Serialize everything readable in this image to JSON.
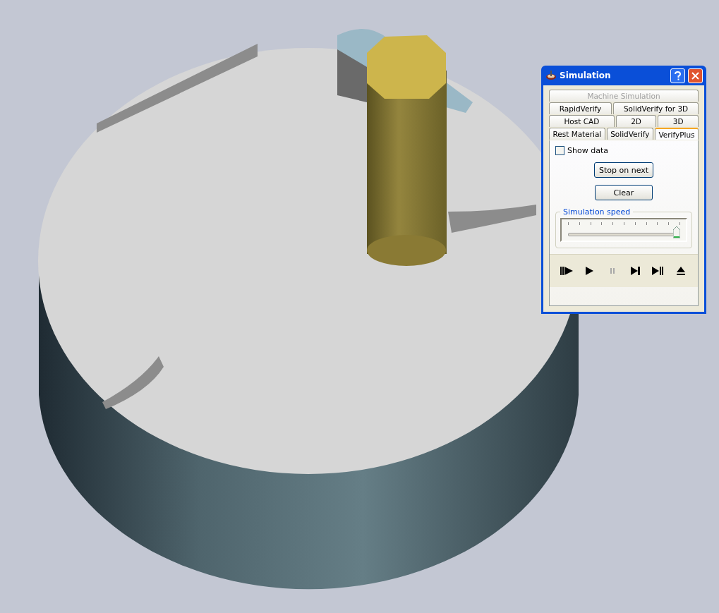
{
  "window": {
    "title": "Simulation"
  },
  "tab_rows": [
    [
      {
        "label": "Machine Simulation",
        "selected": false,
        "disabled": true
      }
    ],
    [
      {
        "label": "RapidVerify",
        "selected": false,
        "disabled": false
      },
      {
        "label": "SolidVerify for 3D",
        "selected": false,
        "disabled": false
      }
    ],
    [
      {
        "label": "Host CAD",
        "selected": false,
        "disabled": false
      },
      {
        "label": "2D",
        "selected": false,
        "disabled": false
      },
      {
        "label": "3D",
        "selected": false,
        "disabled": false
      }
    ],
    [
      {
        "label": "Rest Material",
        "selected": false,
        "disabled": false
      },
      {
        "label": "SolidVerify",
        "selected": false,
        "disabled": false
      },
      {
        "label": "VerifyPlus",
        "selected": true,
        "disabled": false
      }
    ]
  ],
  "show_data": {
    "label": "Show data",
    "checked": false
  },
  "buttons": [
    "Stop on next",
    "Clear"
  ],
  "speed": {
    "label": "Simulation speed",
    "level": 0.98
  },
  "controls": [
    {
      "kind": "step",
      "disabled": false
    },
    {
      "kind": "play",
      "disabled": false
    },
    {
      "kind": "pause",
      "disabled": true
    },
    {
      "kind": "next",
      "disabled": false
    },
    {
      "kind": "end",
      "disabled": false
    },
    {
      "kind": "eject",
      "disabled": false
    }
  ]
}
